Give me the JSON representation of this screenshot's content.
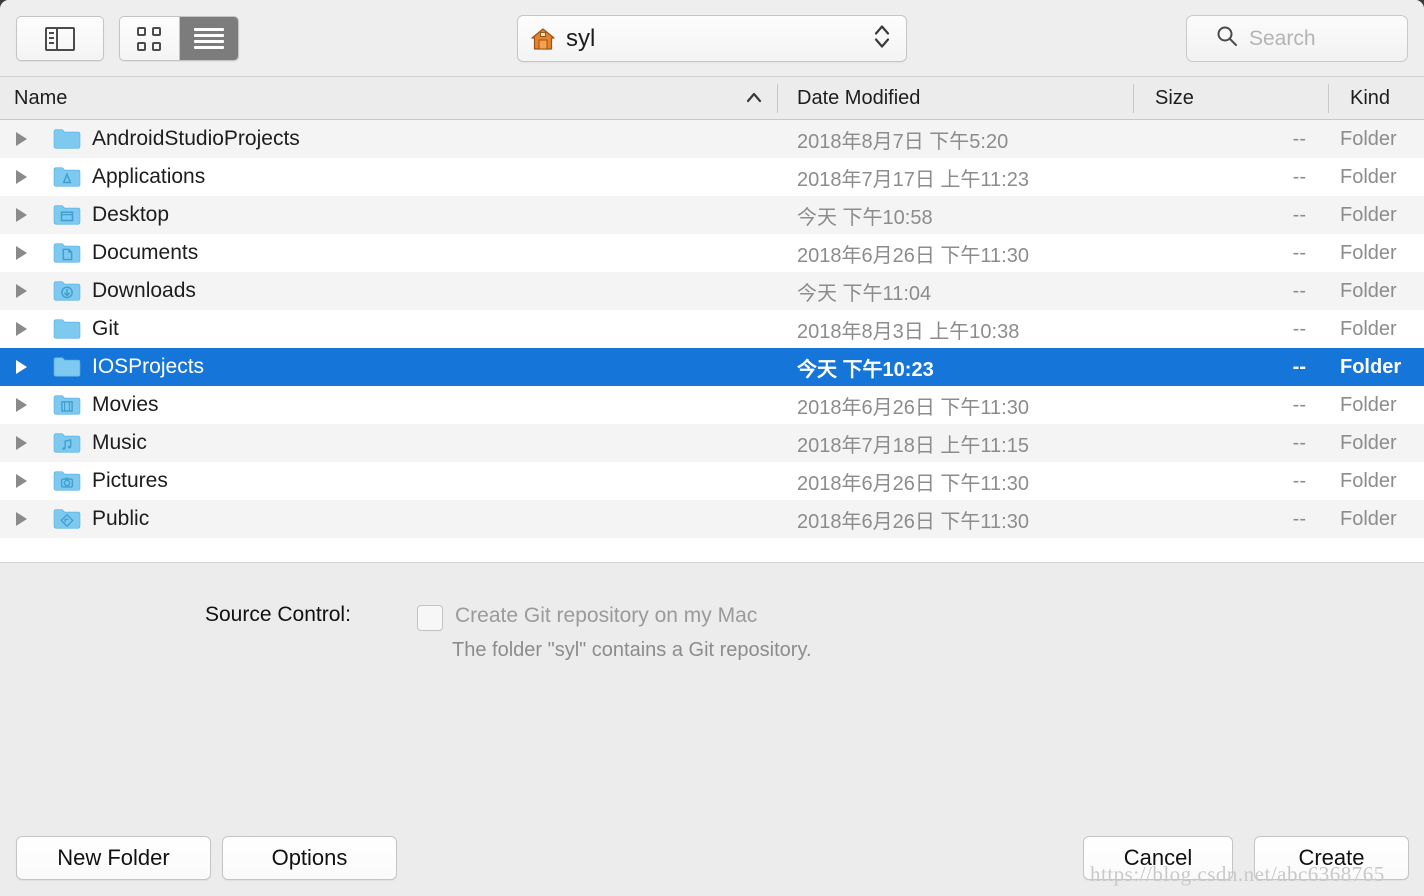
{
  "toolbar": {
    "sidebar_button": "sidebar-toggle",
    "view_icon_label": "icon-view",
    "view_list_label": "list-view",
    "path": {
      "value": "syl",
      "icon": "home-icon"
    },
    "search": {
      "value": "",
      "placeholder": "Search",
      "icon": "search-icon"
    }
  },
  "columns": {
    "name": "Name",
    "date_modified": "Date Modified",
    "size": "Size",
    "kind": "Kind",
    "sort_by": "Name",
    "sort_direction": "ascending"
  },
  "files": [
    {
      "name": "AndroidStudioProjects",
      "date": "2018年8月7日 下午5:20",
      "size": "--",
      "kind": "Folder",
      "icon": "folder-plain-icon",
      "selected": false
    },
    {
      "name": "Applications",
      "date": "2018年7月17日 上午11:23",
      "size": "--",
      "kind": "Folder",
      "icon": "folder-applications-icon",
      "selected": false
    },
    {
      "name": "Desktop",
      "date": "今天 下午10:58",
      "size": "--",
      "kind": "Folder",
      "icon": "folder-desktop-icon",
      "selected": false
    },
    {
      "name": "Documents",
      "date": "2018年6月26日 下午11:30",
      "size": "--",
      "kind": "Folder",
      "icon": "folder-documents-icon",
      "selected": false
    },
    {
      "name": "Downloads",
      "date": "今天 下午11:04",
      "size": "--",
      "kind": "Folder",
      "icon": "folder-downloads-icon",
      "selected": false
    },
    {
      "name": "Git",
      "date": "2018年8月3日 上午10:38",
      "size": "--",
      "kind": "Folder",
      "icon": "folder-plain-icon",
      "selected": false
    },
    {
      "name": "IOSProjects",
      "date": "今天 下午10:23",
      "size": "--",
      "kind": "Folder",
      "icon": "folder-plain-icon",
      "selected": true
    },
    {
      "name": "Movies",
      "date": "2018年6月26日 下午11:30",
      "size": "--",
      "kind": "Folder",
      "icon": "folder-movies-icon",
      "selected": false
    },
    {
      "name": "Music",
      "date": "2018年7月18日 上午11:15",
      "size": "--",
      "kind": "Folder",
      "icon": "folder-music-icon",
      "selected": false
    },
    {
      "name": "Pictures",
      "date": "2018年6月26日 下午11:30",
      "size": "--",
      "kind": "Folder",
      "icon": "folder-pictures-icon",
      "selected": false
    },
    {
      "name": "Public",
      "date": "2018年6月26日 下午11:30",
      "size": "--",
      "kind": "Folder",
      "icon": "folder-public-icon",
      "selected": false
    }
  ],
  "source_control": {
    "label": "Source Control:",
    "checkbox_label": "Create Git repository on my Mac",
    "checked": false,
    "hint": "The folder \"syl\" contains a Git repository."
  },
  "buttons": {
    "new_folder": "New Folder",
    "options": "Options",
    "cancel": "Cancel",
    "create": "Create"
  },
  "watermark": "https://blog.csdn.net/abc6368765",
  "colors": {
    "selection_blue": "#1675d8",
    "toolbar_bg": "#eeeeee",
    "row_stripe": "#f4f4f4",
    "folder_blue": "#6fc4ef",
    "secondary_text": "#8c8c8c"
  }
}
